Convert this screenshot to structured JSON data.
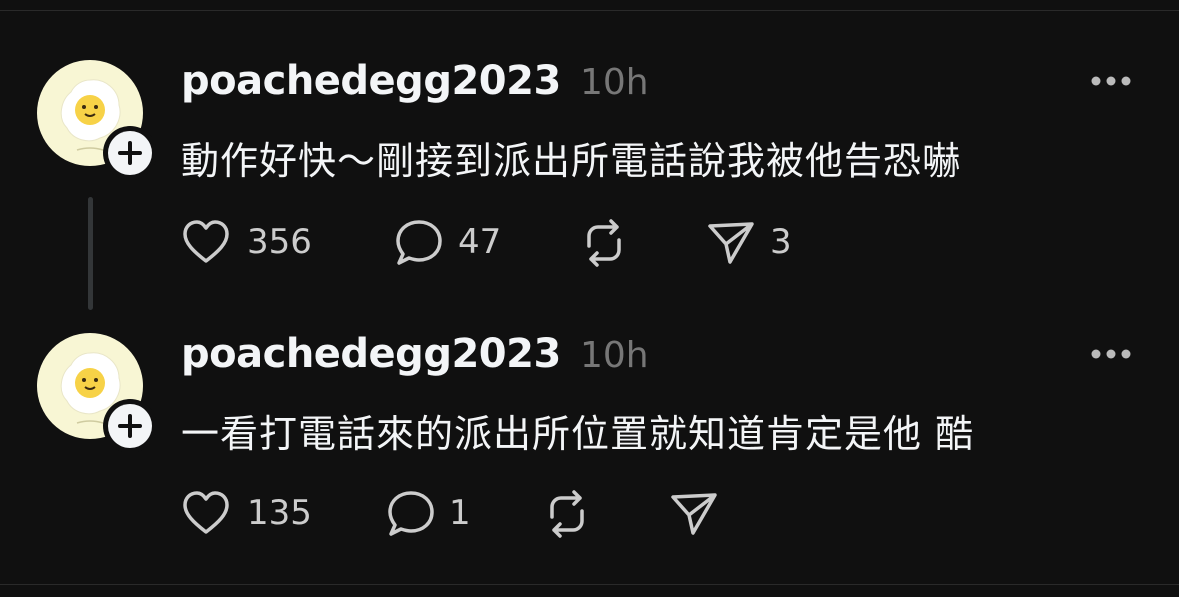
{
  "posts": [
    {
      "username": "poachedegg2023",
      "timestamp": "10h",
      "text": "動作好快～剛接到派出所電話說我被他告恐嚇",
      "likes": "356",
      "replies": "47",
      "shares": "3"
    },
    {
      "username": "poachedegg2023",
      "timestamp": "10h",
      "text": "一看打電話來的派出所位置就知道肯定是他 酷",
      "likes": "135",
      "replies": "1"
    }
  ],
  "icons": {
    "like": "heart-icon",
    "reply": "comment-icon",
    "repost": "repost-icon",
    "share": "send-icon",
    "more": "more-icon",
    "follow": "plus-icon"
  },
  "colors": {
    "background": "#101010",
    "text": "#f3f5f7",
    "muted": "#777777"
  }
}
